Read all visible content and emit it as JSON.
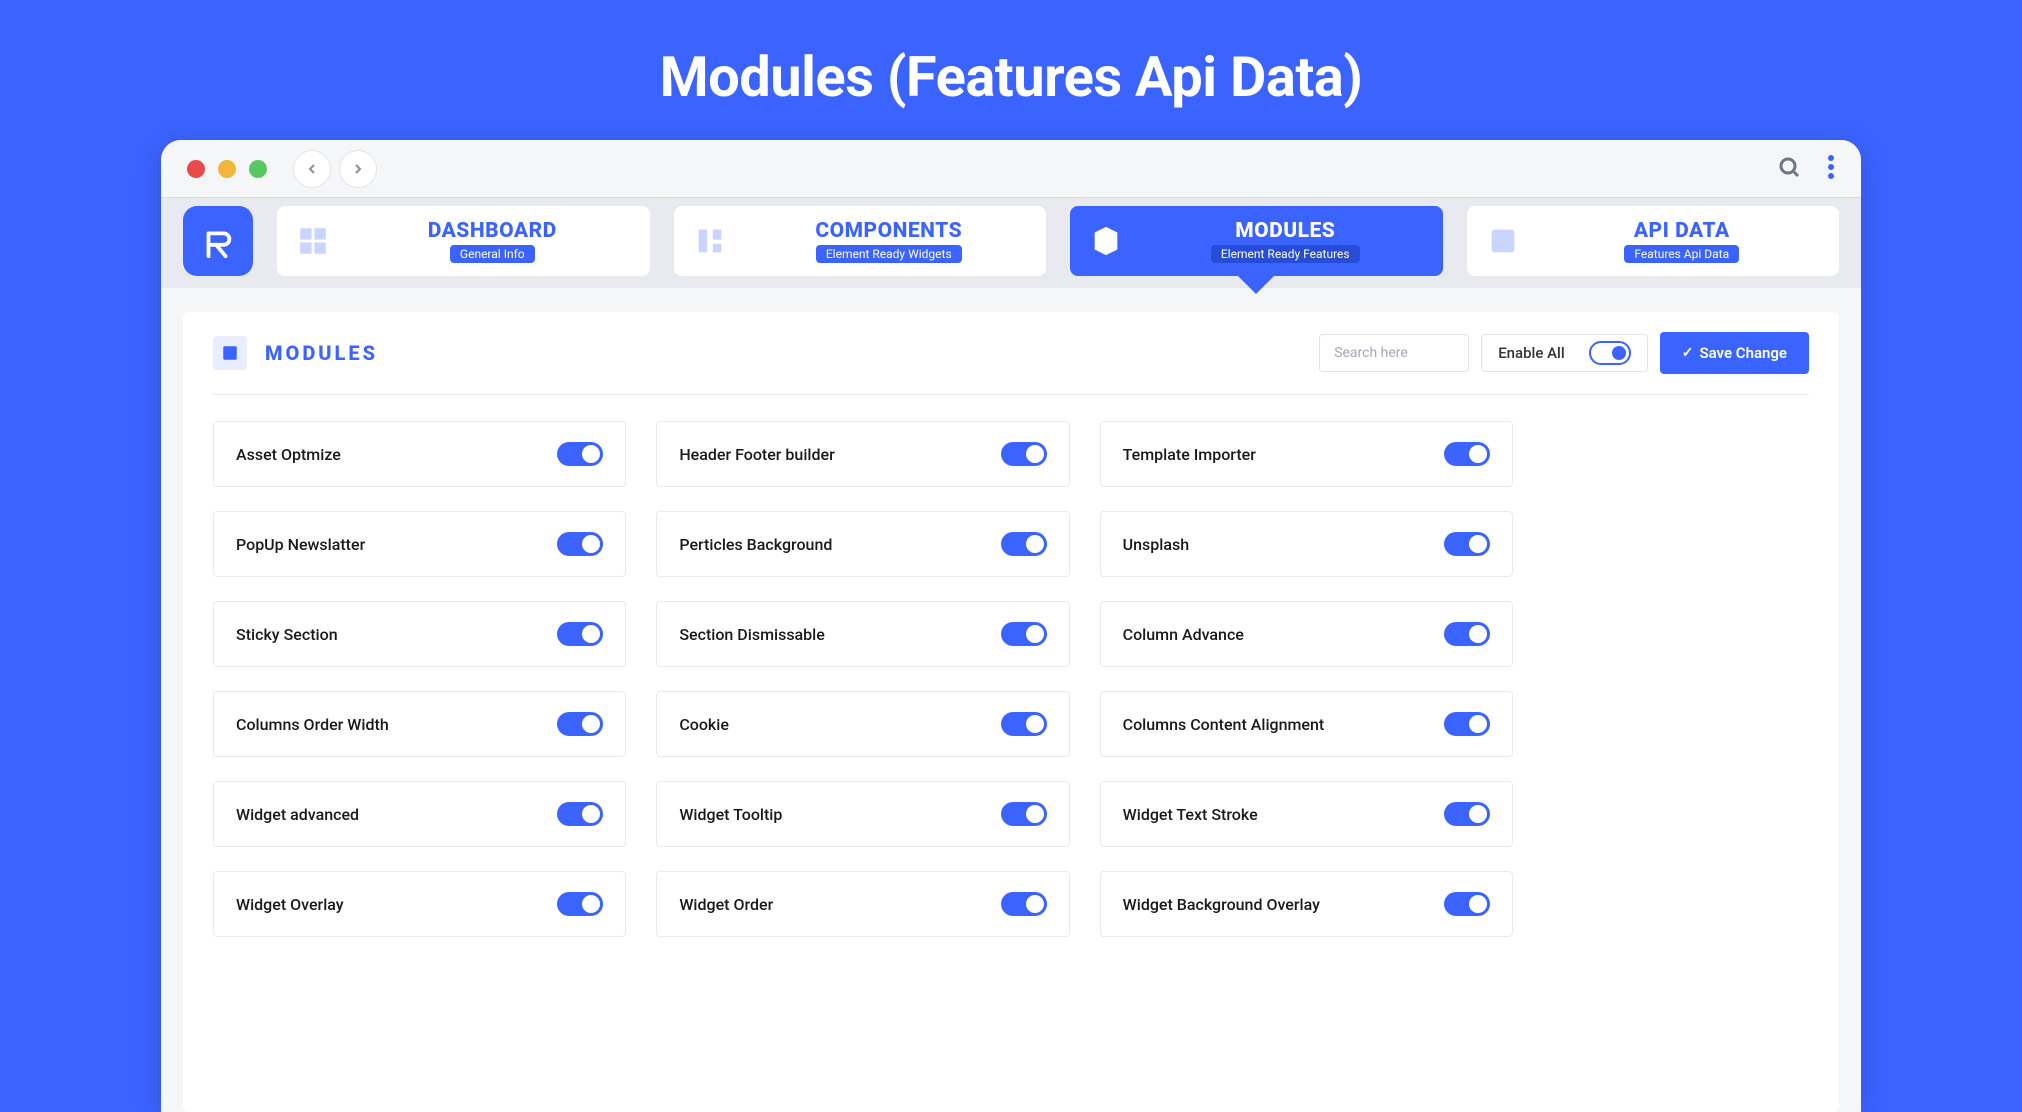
{
  "page_title": "Modules (Features Api Data)",
  "tabs": [
    {
      "title": "DASHBOARD",
      "sub": "General Info",
      "active": false
    },
    {
      "title": "COMPONENTS",
      "sub": "Element Ready Widgets",
      "active": false
    },
    {
      "title": "MODULES",
      "sub": "Element Ready Features",
      "active": true
    },
    {
      "title": "API DATA",
      "sub": "Features Api Data",
      "active": false
    }
  ],
  "card": {
    "title": "MODULES",
    "search_placeholder": "Search here",
    "enable_all_label": "Enable All",
    "save_label": "Save Change"
  },
  "modules": [
    {
      "label": "Asset Optmize",
      "on": true
    },
    {
      "label": "Header Footer builder",
      "on": true
    },
    {
      "label": "Template Importer",
      "on": true
    },
    {
      "label": "PopUp Newslatter",
      "on": true
    },
    {
      "label": "Perticles Background",
      "on": true
    },
    {
      "label": "Unsplash",
      "on": true
    },
    {
      "label": "Sticky Section",
      "on": true
    },
    {
      "label": "Section Dismissable",
      "on": true
    },
    {
      "label": "Column Advance",
      "on": true
    },
    {
      "label": "Columns Order Width",
      "on": true
    },
    {
      "label": "Cookie",
      "on": true
    },
    {
      "label": "Columns Content Alignment",
      "on": true
    },
    {
      "label": "Widget advanced",
      "on": true
    },
    {
      "label": "Widget Tooltip",
      "on": true
    },
    {
      "label": "Widget Text Stroke",
      "on": true
    },
    {
      "label": "Widget Overlay",
      "on": true
    },
    {
      "label": "Widget Order",
      "on": true
    },
    {
      "label": "Widget Background Overlay",
      "on": true
    }
  ]
}
